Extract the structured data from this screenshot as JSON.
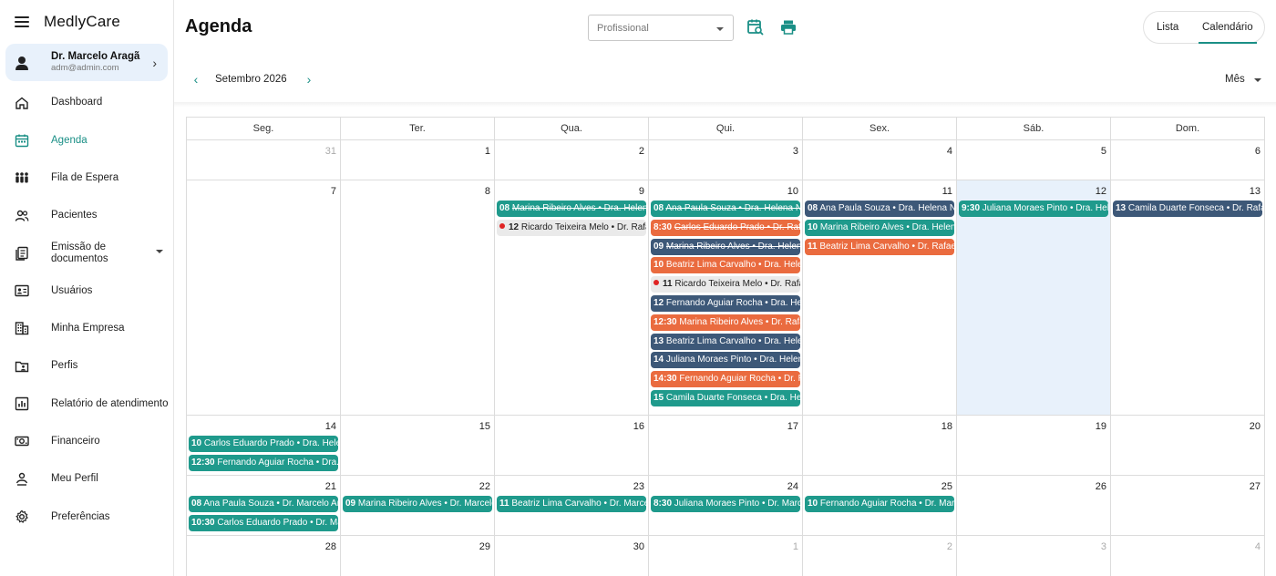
{
  "app": {
    "name": "MedlyCare"
  },
  "user": {
    "name": "Dr. Marcelo Aragã",
    "email": "adm@admin.com"
  },
  "nav": [
    {
      "label": "Dashboard",
      "icon": "home-icon",
      "name": "sidebar-item-dashboard"
    },
    {
      "label": "Agenda",
      "icon": "calendar-icon",
      "name": "sidebar-item-agenda",
      "active": true
    },
    {
      "label": "Fila de Espera",
      "icon": "queue-icon",
      "name": "sidebar-item-fila-de-espera"
    },
    {
      "label": "Pacientes",
      "icon": "people-icon",
      "name": "sidebar-item-pacientes"
    },
    {
      "label": "Emissão de documentos",
      "icon": "document-icon",
      "name": "sidebar-item-emissao-documentos",
      "expandable": true
    },
    {
      "label": "Usuários",
      "icon": "id-card-icon",
      "name": "sidebar-item-usuarios"
    },
    {
      "label": "Minha Empresa",
      "icon": "building-icon",
      "name": "sidebar-item-minha-empresa"
    },
    {
      "label": "Perfis",
      "icon": "folder-user-icon",
      "name": "sidebar-item-perfis"
    },
    {
      "label": "Relatório de atendimento",
      "icon": "report-icon",
      "name": "sidebar-item-relatorio"
    },
    {
      "label": "Financeiro",
      "icon": "money-icon",
      "name": "sidebar-item-financeiro"
    },
    {
      "label": "Meu Perfil",
      "icon": "user-icon",
      "name": "sidebar-item-meu-perfil"
    },
    {
      "label": "Preferências",
      "icon": "gear-icon",
      "name": "sidebar-item-preferencias"
    }
  ],
  "header": {
    "title": "Agenda",
    "professional_placeholder": "Profissional",
    "view_list": "Lista",
    "view_calendar": "Calendário"
  },
  "subheader": {
    "month": "Setembro 2026",
    "period": "Mês"
  },
  "calendar": {
    "weekdays": [
      "Seg.",
      "Ter.",
      "Qua.",
      "Qui.",
      "Sex.",
      "Sáb.",
      "Dom."
    ],
    "weeks": [
      {
        "height": 44,
        "days": [
          {
            "num": "31",
            "muted": true,
            "events": []
          },
          {
            "num": "1",
            "events": []
          },
          {
            "num": "2",
            "events": []
          },
          {
            "num": "3",
            "events": []
          },
          {
            "num": "4",
            "events": []
          },
          {
            "num": "5",
            "events": []
          },
          {
            "num": "6",
            "events": []
          }
        ]
      },
      {
        "height": 258,
        "days": [
          {
            "num": "7",
            "events": []
          },
          {
            "num": "8",
            "events": []
          },
          {
            "num": "9",
            "events": [
              {
                "time": "08",
                "text": "Marina Ribeiro Alves • Dra. Helena",
                "color": "teal",
                "strike": true
              },
              {
                "time": "12",
                "text": "Ricardo Teixeira Melo • Dr. Rafael",
                "color": "light",
                "dot": true
              }
            ]
          },
          {
            "num": "10",
            "events": [
              {
                "time": "08",
                "text": "Ana Paula Souza • Dra. Helena Nogueira",
                "color": "teal",
                "strike": true
              },
              {
                "time": "8:30",
                "text": "Carlos Eduardo Prado • Dr. Rafael",
                "color": "orange",
                "strike": true
              },
              {
                "time": "09",
                "text": "Marina Ribeiro Alves • Dra. Helena",
                "color": "navy",
                "strike": true
              },
              {
                "time": "10",
                "text": "Beatriz Lima Carvalho • Dra. Helena",
                "color": "orange"
              },
              {
                "time": "11",
                "text": "Ricardo Teixeira Melo • Dr. Rafael",
                "color": "light",
                "dot": true
              },
              {
                "time": "12",
                "text": "Fernando Aguiar Rocha • Dra. Helena",
                "color": "navy"
              },
              {
                "time": "12:30",
                "text": "Marina Ribeiro Alves • Dr. Rafael",
                "color": "orange"
              },
              {
                "time": "13",
                "text": "Beatriz Lima Carvalho • Dra. Helena",
                "color": "navy"
              },
              {
                "time": "14",
                "text": "Juliana Moraes Pinto • Dra. Helena",
                "color": "navy"
              },
              {
                "time": "14:30",
                "text": "Fernando Aguiar Rocha • Dr. Rafael",
                "color": "orange"
              },
              {
                "time": "15",
                "text": "Camila Duarte Fonseca • Dra. Helena",
                "color": "teal"
              }
            ]
          },
          {
            "num": "11",
            "events": [
              {
                "time": "08",
                "text": "Ana Paula Souza • Dra. Helena Nogueira",
                "color": "navy"
              },
              {
                "time": "10",
                "text": "Marina Ribeiro Alves • Dra. Helena",
                "color": "teal"
              },
              {
                "time": "11",
                "text": "Beatriz Lima Carvalho • Dr. Rafael",
                "color": "orange"
              }
            ]
          },
          {
            "num": "12",
            "today": true,
            "events": [
              {
                "time": "9:30",
                "text": "Juliana Moraes Pinto • Dra. Helena",
                "color": "teal"
              }
            ]
          },
          {
            "num": "13",
            "events": [
              {
                "time": "13",
                "text": "Camila Duarte Fonseca • Dr. Rafael",
                "color": "navy"
              }
            ]
          }
        ]
      },
      {
        "height": 66,
        "days": [
          {
            "num": "14",
            "events": [
              {
                "time": "10",
                "text": "Carlos Eduardo Prado • Dra. Helena",
                "color": "teal"
              },
              {
                "time": "12:30",
                "text": "Fernando Aguiar Rocha • Dra. Helena",
                "color": "teal"
              }
            ]
          },
          {
            "num": "15",
            "events": []
          },
          {
            "num": "16",
            "events": []
          },
          {
            "num": "17",
            "events": []
          },
          {
            "num": "18",
            "events": []
          },
          {
            "num": "19",
            "events": []
          },
          {
            "num": "20",
            "events": []
          }
        ]
      },
      {
        "height": 66,
        "days": [
          {
            "num": "21",
            "events": [
              {
                "time": "08",
                "text": "Ana Paula Souza • Dr. Marcelo Aragão",
                "color": "teal"
              },
              {
                "time": "10:30",
                "text": "Carlos Eduardo Prado • Dr. Marcelo",
                "color": "teal"
              }
            ]
          },
          {
            "num": "22",
            "events": [
              {
                "time": "09",
                "text": "Marina Ribeiro Alves • Dr. Marcelo",
                "color": "teal"
              }
            ]
          },
          {
            "num": "23",
            "events": [
              {
                "time": "11",
                "text": "Beatriz Lima Carvalho • Dr. Marcelo",
                "color": "teal"
              }
            ]
          },
          {
            "num": "24",
            "events": [
              {
                "time": "8:30",
                "text": "Juliana Moraes Pinto • Dr. Marcelo",
                "color": "teal"
              }
            ]
          },
          {
            "num": "25",
            "events": [
              {
                "time": "10",
                "text": "Fernando Aguiar Rocha • Dr. Marcelo",
                "color": "teal"
              }
            ]
          },
          {
            "num": "26",
            "events": []
          },
          {
            "num": "27",
            "events": []
          }
        ]
      },
      {
        "height": 60,
        "days": [
          {
            "num": "28",
            "events": []
          },
          {
            "num": "29",
            "events": []
          },
          {
            "num": "30",
            "events": []
          },
          {
            "num": "1",
            "muted": true,
            "events": []
          },
          {
            "num": "2",
            "muted": true,
            "events": []
          },
          {
            "num": "3",
            "muted": true,
            "events": []
          },
          {
            "num": "4",
            "muted": true,
            "events": []
          }
        ]
      }
    ]
  },
  "colors": {
    "accent": "#1a8f86",
    "teal": "#1f9a8c",
    "navy": "#3d5878",
    "orange": "#ea6b3f",
    "today_bg": "#e8f1fb"
  }
}
